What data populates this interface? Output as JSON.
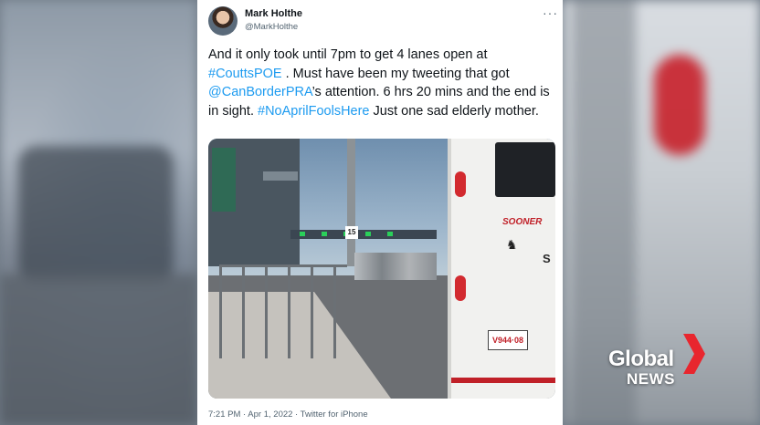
{
  "tweet": {
    "author_name": "Mark Holthe",
    "author_handle": "@MarkHolthe",
    "more_icon": "···",
    "text_1": "And it only took until 7pm to get 4 lanes open at ",
    "hashtag_1": "#CouttsPOE",
    "text_2": " . Must have been my tweeting that got ",
    "mention_1": "@CanBorderPRA",
    "text_3": "’s attention. 6 hrs 20 mins and the end is in sight. ",
    "hashtag_2": "#NoAprilFoolsHere",
    "text_4": " Just one sad elderly mother.",
    "timestamp": "7:21 PM · Apr 1, 2022 · Twitter for iPhone"
  },
  "media": {
    "lane_number": "15",
    "trailer_brand": "SOONER",
    "trailer_side_text": "S",
    "license_plate": "V944·08"
  },
  "watermark": {
    "line1": "Global",
    "line2": "NEWS",
    "accent_color": "#e8262e"
  },
  "colors": {
    "link": "#1d9bf0",
    "text": "#0f1419",
    "secondary": "#536471"
  }
}
